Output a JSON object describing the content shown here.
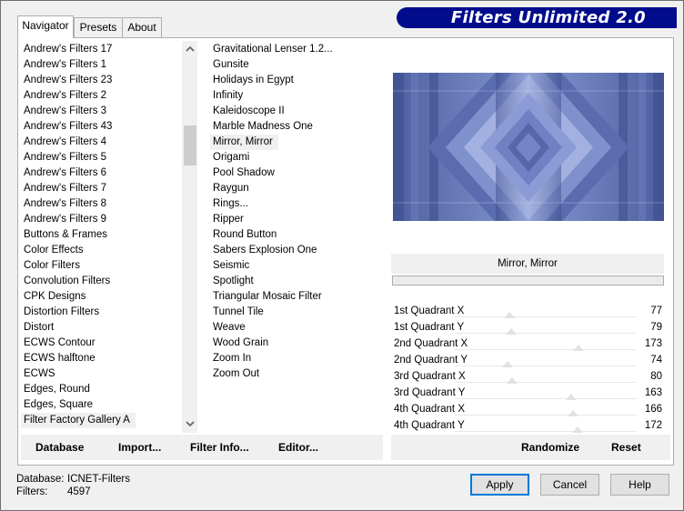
{
  "title": "Filters Unlimited 2.0",
  "tabs": [
    "Navigator",
    "Presets",
    "About"
  ],
  "categories": [
    "Andrew's Filters 17",
    "Andrew's Filters 1",
    "Andrew's Filters 23",
    "Andrew's Filters 2",
    "Andrew's Filters 3",
    "Andrew's Filters 43",
    "Andrew's Filters 4",
    "Andrew's Filters 5",
    "Andrew's Filters 6",
    "Andrew's Filters 7",
    "Andrew's Filters 8",
    "Andrew's Filters 9",
    "Buttons & Frames",
    "Color Effects",
    "Color Filters",
    "Convolution Filters",
    "CPK Designs",
    "Distortion Filters",
    "Distort",
    "ECWS Contour",
    "ECWS halftone",
    "ECWS",
    "Edges, Round",
    "Edges, Square",
    "Filter Factory Gallery A"
  ],
  "selected_category": "Filter Factory Gallery A",
  "filters": [
    "Gravitational Lenser 1.2...",
    "Gunsite",
    "Holidays in Egypt",
    "Infinity",
    "Kaleidoscope II",
    "Marble Madness One",
    "Mirror, Mirror",
    "Origami",
    "Pool Shadow",
    "Raygun",
    "Rings...",
    "Ripper",
    "Round Button",
    "Sabers Explosion One",
    "Seismic",
    "Spotlight",
    "Triangular Mosaic Filter",
    "Tunnel Tile",
    "Weave",
    "Wood Grain",
    "Zoom In",
    "Zoom Out"
  ],
  "selected_filter": "Mirror, Mirror",
  "preview_filter_name": "Mirror, Mirror",
  "params": [
    {
      "label": "1st Quadrant X",
      "value": 77,
      "max": 255
    },
    {
      "label": "1st Quadrant Y",
      "value": 79,
      "max": 255
    },
    {
      "label": "2nd Quadrant X",
      "value": 173,
      "max": 255
    },
    {
      "label": "2nd Quadrant Y",
      "value": 74,
      "max": 255
    },
    {
      "label": "3rd Quadrant X",
      "value": 80,
      "max": 255
    },
    {
      "label": "3rd Quadrant Y",
      "value": 163,
      "max": 255
    },
    {
      "label": "4th Quadrant X",
      "value": 166,
      "max": 255
    },
    {
      "label": "4th Quadrant Y",
      "value": 172,
      "max": 255
    }
  ],
  "left_buttons": {
    "database": "Database",
    "import": "Import...",
    "filter_info": "Filter Info...",
    "editor": "Editor..."
  },
  "right_buttons": {
    "randomize": "Randomize",
    "reset": "Reset"
  },
  "status": {
    "database_label": "Database:",
    "database_value": "ICNET-Filters",
    "filters_label": "Filters:",
    "filters_value": "4597"
  },
  "dialog_buttons": {
    "apply": "Apply",
    "cancel": "Cancel",
    "help": "Help"
  },
  "icons": {
    "scroll_up": "chevron-up-icon",
    "scroll_down": "chevron-down-icon"
  },
  "colors": {
    "banner": "#000c8c",
    "preview_dark": "#3d4e8f",
    "preview_light": "#b2bfe8",
    "default_button_border": "#0078d7"
  }
}
